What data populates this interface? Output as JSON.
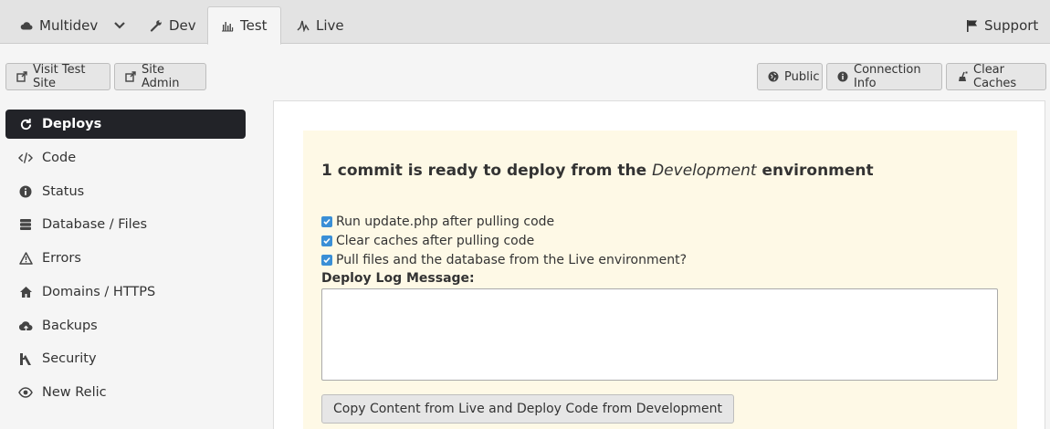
{
  "tabs": {
    "multidev": "Multidev",
    "dev": "Dev",
    "test": "Test",
    "live": "Live",
    "support": "Support"
  },
  "toolbar": {
    "visit_site": "Visit Test Site",
    "site_admin": "Site Admin",
    "public": "Public",
    "connection_info": "Connection Info",
    "clear_caches": "Clear Caches"
  },
  "sidebar": {
    "items": [
      {
        "label": "Deploys",
        "icon": "refresh-icon"
      },
      {
        "label": "Code",
        "icon": "code-icon"
      },
      {
        "label": "Status",
        "icon": "info-icon"
      },
      {
        "label": "Database / Files",
        "icon": "database-icon"
      },
      {
        "label": "Errors",
        "icon": "warning-icon"
      },
      {
        "label": "Domains / HTTPS",
        "icon": "home-icon"
      },
      {
        "label": "Backups",
        "icon": "cloud-upload-icon"
      },
      {
        "label": "Security",
        "icon": "key-icon"
      },
      {
        "label": "New Relic",
        "icon": "eye-icon"
      }
    ],
    "active_index": 0
  },
  "deploy": {
    "headline_prefix": "1 commit is ready to deploy from the ",
    "headline_env": "Development",
    "headline_suffix": " environment",
    "options": [
      {
        "label": "Run update.php after pulling code",
        "checked": true
      },
      {
        "label": "Clear caches after pulling code",
        "checked": true
      },
      {
        "label": "Pull files and the database from the Live environment?",
        "checked": true
      }
    ],
    "log_label": "Deploy Log Message:",
    "log_value": "",
    "button_label": "Copy Content from Live and Deploy Code from Development"
  },
  "colors": {
    "active_nav_bg": "#222328",
    "callout_bg": "#fef9e6",
    "checkbox_blue": "#3a8fd6"
  }
}
